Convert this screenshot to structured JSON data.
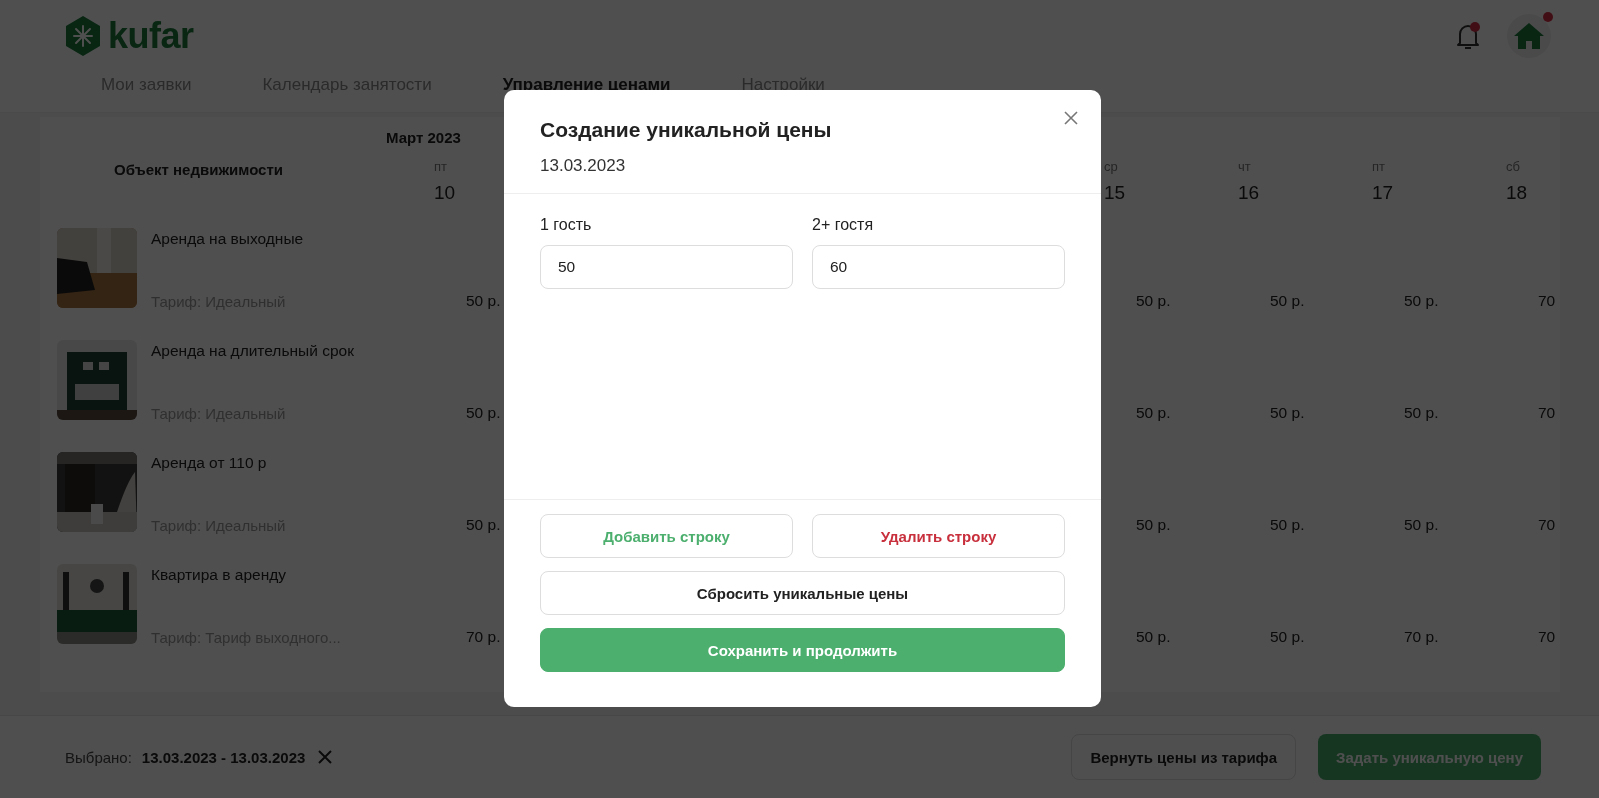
{
  "logo": {
    "text": "kufar"
  },
  "header": {
    "notifications": {
      "unread": true
    },
    "account": {
      "unread": true
    }
  },
  "tabs": [
    {
      "label": "Мои заявки",
      "selected": false
    },
    {
      "label": "Календарь занятости",
      "selected": false
    },
    {
      "label": "Управление ценами",
      "selected": true
    },
    {
      "label": "Настройки",
      "selected": false
    }
  ],
  "calendar": {
    "month": "Март 2023",
    "property_header": "Объект недвижимости",
    "days": [
      {
        "weekday": "пт",
        "date": "10"
      },
      {
        "weekday": "ср",
        "date": "15"
      },
      {
        "weekday": "чт",
        "date": "16"
      },
      {
        "weekday": "пт",
        "date": "17"
      },
      {
        "weekday": "сб",
        "date": "18"
      }
    ],
    "rows": [
      {
        "title": "Аренда на выходные",
        "tariff": "Тариф: Идеальный",
        "prices": [
          "50 р.",
          "50 р.",
          "50 р.",
          "50 р.",
          "70"
        ]
      },
      {
        "title": "Аренда на длительный срок",
        "tariff": "Тариф: Идеальный",
        "prices": [
          "50 р.",
          "50 р.",
          "50 р.",
          "50 р.",
          "70"
        ]
      },
      {
        "title": "Аренда от 110 р",
        "tariff": "Тариф: Идеальный",
        "prices": [
          "50 р.",
          "50 р.",
          "50 р.",
          "50 р.",
          "70"
        ]
      },
      {
        "title": "Квартира в аренду",
        "tariff": "Тариф: Тариф выходного...",
        "prices": [
          "70 р.",
          "50 р.",
          "50 р.",
          "70 р.",
          "70"
        ]
      }
    ]
  },
  "modal": {
    "title": "Создание уникальной цены",
    "date": "13.03.2023",
    "fields": [
      {
        "label": "1 гость",
        "value": "50"
      },
      {
        "label": "2+ гостя",
        "value": "60"
      }
    ],
    "buttons": [
      {
        "label": "Добавить строку",
        "kind": "add"
      },
      {
        "label": "Удалить строку",
        "kind": "delete"
      },
      {
        "label": "Сбросить уникальные цены",
        "kind": "reset"
      },
      {
        "label": "Сохранить и продолжить",
        "kind": "primary"
      }
    ]
  },
  "footer": {
    "selected_label": "Выбрано:",
    "selected_range": "13.03.2023 - 13.03.2023",
    "buttons": [
      {
        "label": "Вернуть цены из тарифа",
        "kind": "secondary"
      },
      {
        "label": "Задать уникальную цену",
        "kind": "primary"
      }
    ]
  }
}
